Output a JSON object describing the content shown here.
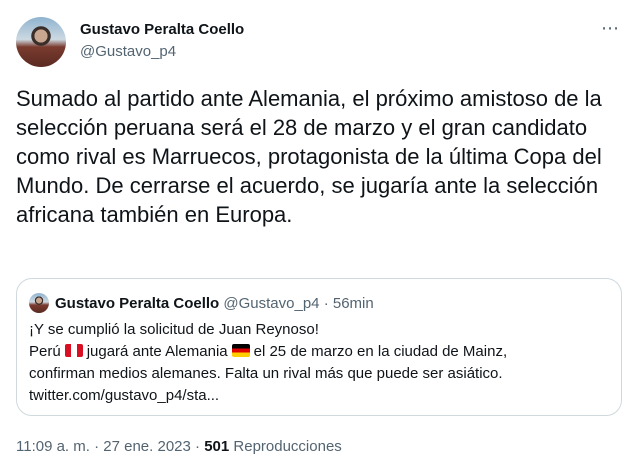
{
  "author": {
    "name": "Gustavo Peralta Coello",
    "handle": "@Gustavo_p4"
  },
  "more_icon": "⋯",
  "tweet": {
    "text": "Sumado al partido ante Alemania, el próximo amistoso de la selección peruana será el 28 de marzo y el gran candidato como rival es Marruecos, protagonista de la última Copa del Mundo. De cerrarse el acuerdo, se jugaría ante la selección africana también en Europa."
  },
  "quote": {
    "name": "Gustavo Peralta Coello",
    "handle": "@Gustavo_p4",
    "separator": "·",
    "time": "56min",
    "line1": "¡Y se cumplió la solicitud de Juan Reynoso!",
    "line2_a": "Perú",
    "line2_b": "jugará ante Alemania",
    "line2_c": "el 25 de marzo en la ciudad de Mainz,",
    "line3": "confirman medios alemanes. Falta un rival más que puede ser asiático.",
    "link": "twitter.com/gustavo_p4/sta..."
  },
  "footer": {
    "timestamp": "11:09 a. m. · 27 ene. 2023 ·",
    "views_count": "501",
    "views_label": "Reproducciones"
  },
  "colors": {
    "text": "#0f1419",
    "secondary": "#536471",
    "border": "#cfd9de"
  }
}
